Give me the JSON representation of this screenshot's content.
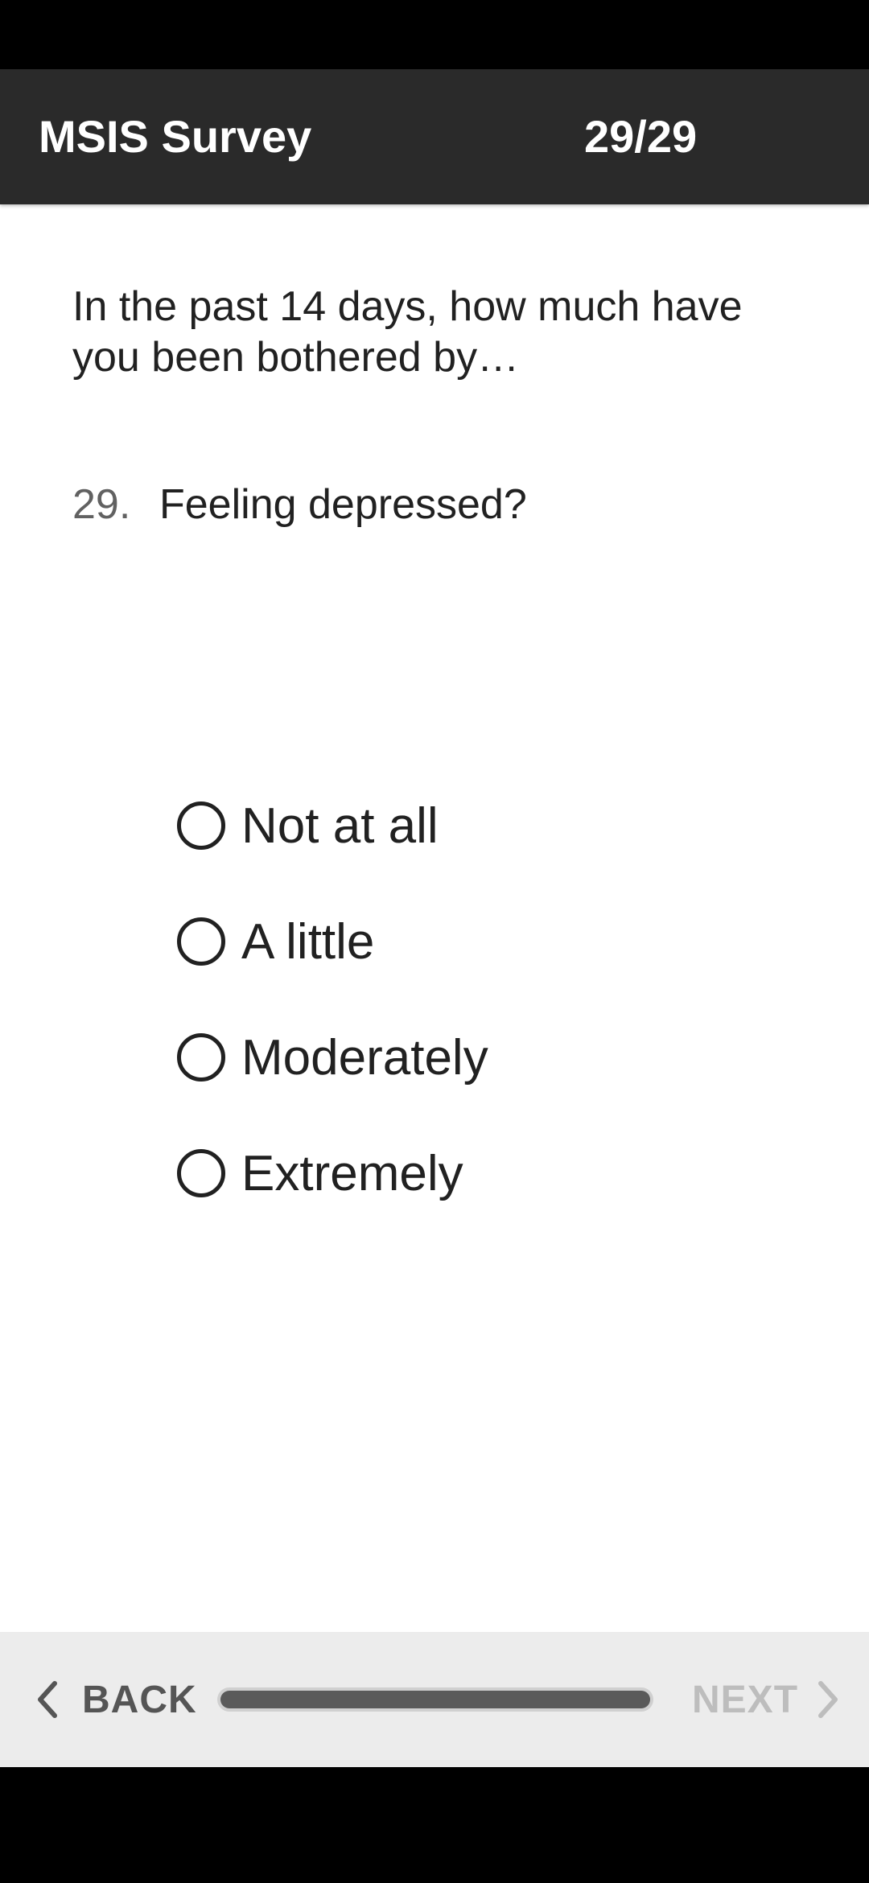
{
  "app_bar": {
    "title": "MSIS Survey",
    "progress_text": "29/29"
  },
  "question": {
    "intro": "In the past 14 days, how much have you been bothered by…",
    "number": "29.",
    "text": "Feeling depressed?"
  },
  "options": [
    {
      "label": "Not at all",
      "selected": false
    },
    {
      "label": "A little",
      "selected": false
    },
    {
      "label": "Moderately",
      "selected": false
    },
    {
      "label": "Extremely",
      "selected": false
    }
  ],
  "footer": {
    "back_label": "BACK",
    "next_label": "NEXT",
    "progress_fraction": 1.0,
    "next_enabled": false
  },
  "colors": {
    "app_bar_bg": "#2a2a2a",
    "footer_bg": "#ececec",
    "progress_fill": "#5a5a5a",
    "disabled_text": "#bdbdbd"
  }
}
